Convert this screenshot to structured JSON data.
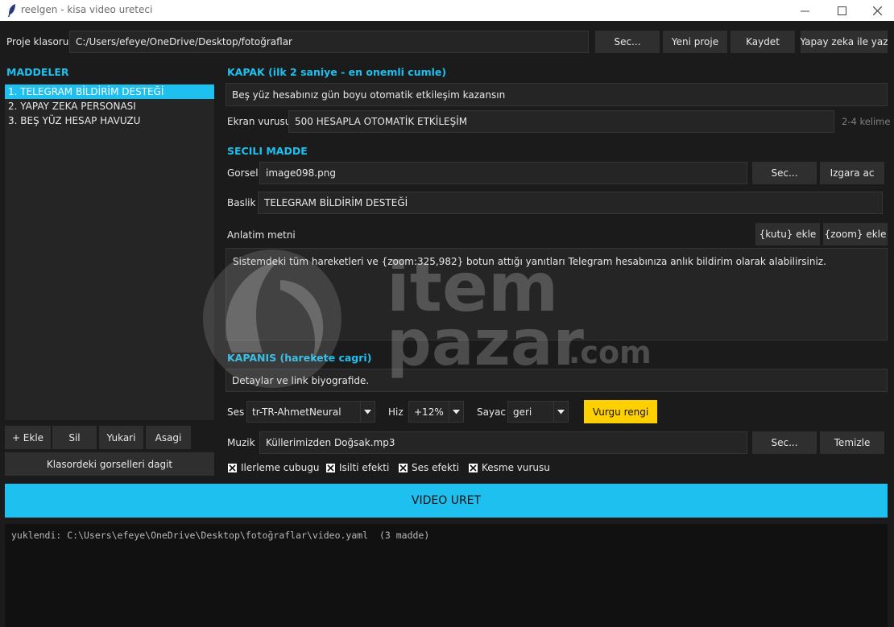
{
  "window": {
    "title": "reelgen - kisa video ureteci"
  },
  "project": {
    "label": "Proje klasoru",
    "path": "C:/Users/efeye/OneDrive/Desktop/fotoğraflar",
    "browse_label": "Sec...",
    "new_label": "Yeni proje",
    "save_label": "Kaydet",
    "ai_label": "Yapay zeka ile yaz"
  },
  "items": {
    "heading": "MADDELER",
    "list": [
      "1. TELEGRAM BİLDİRİM DESTEĞİ",
      "2. YAPAY ZEKA PERSONASI",
      "3. BEŞ YÜZ HESAP HAVUZU"
    ],
    "selected_index": 0,
    "add_label": "+ Ekle",
    "delete_label": "Sil",
    "up_label": "Yukari",
    "down_label": "Asagi",
    "distribute_label": "Klasordeki gorselleri dagit"
  },
  "cover": {
    "heading": "KAPAK (ilk 2 saniye - en onemli cumle)",
    "sentence": "Beş yüz hesabınız gün boyu otomatik etkileşim kazansın",
    "screen_hit_label": "Ekran vurusu",
    "screen_hit_value": "500 HESAPLA OTOMATİK ETKİLEŞİM",
    "screen_hit_hint": "2-4 kelime"
  },
  "selected_item": {
    "heading": "SECILI MADDE",
    "image_label": "Gorsel",
    "image_value": "image098.png",
    "image_browse_label": "Sec...",
    "grid_label": "Izgara ac",
    "title_label": "Baslik",
    "title_value": "TELEGRAM BİLDİRİM DESTEĞİ",
    "narration_label": "Anlatim metni",
    "box_tag_label": "{kutu} ekle",
    "zoom_tag_label": "{zoom} ekle",
    "narration_text": "Sistemdeki tüm hareketleri ve {zoom:325,982} botun attığı yanıtları Telegram hesabınıza anlık bildirim olarak alabilirsiniz."
  },
  "closing": {
    "heading": "KAPANIS (harekete cagri)",
    "text": "Detaylar ve link biyografide."
  },
  "audio": {
    "voice_label": "Ses",
    "voice_value": "tr-TR-AhmetNeural",
    "speed_label": "Hiz",
    "speed_value": "+12%",
    "counter_label": "Sayac",
    "counter_value": "geri",
    "accent_label": "Vurgu rengi",
    "accent_color": "#ffd000",
    "music_label": "Muzik",
    "music_value": "Küllerimizden Doğsak.mp3",
    "music_browse_label": "Sec...",
    "music_clear_label": "Temizle"
  },
  "options": {
    "progress_bar": "Ilerleme cubugu",
    "glow_effect": "Isilti efekti",
    "sound_effect": "Ses efekti",
    "cut_hit": "Kesme vurusu"
  },
  "generate_label": "VIDEO URET",
  "log": {
    "line": "yuklendi: C:\\Users\\efeye\\OneDrive\\Desktop\\fotoğraflar\\video.yaml  (3 madde)"
  },
  "watermark": {
    "brand": "item",
    "brand2": "pazar",
    "domain": ".com"
  },
  "colors": {
    "accent": "#1ec0ef",
    "background": "#1b1b1b",
    "field": "#252525",
    "button": "#2f2f2f"
  }
}
